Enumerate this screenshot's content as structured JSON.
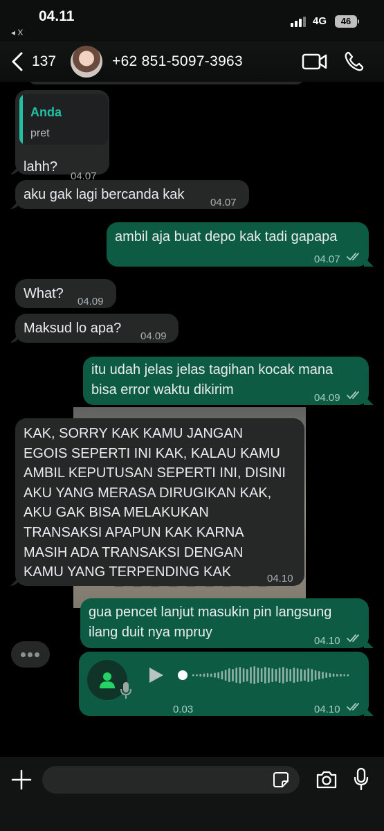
{
  "status_bar": {
    "time": "04.11",
    "back_app": "◂ X",
    "network": "4G",
    "battery": "46"
  },
  "header": {
    "unread_count": "137",
    "contact_name": "+62 851-5097-3963"
  },
  "messages": [
    {
      "id": "m1",
      "direction": "in",
      "quote_author": "Anda",
      "quote_text": "pret",
      "text": "lahh?",
      "time": "04.07"
    },
    {
      "id": "m2",
      "direction": "in",
      "text": "aku gak lagi bercanda kak",
      "time": "04.07"
    },
    {
      "id": "m3",
      "direction": "out",
      "text": "ambil aja buat depo kak tadi gapapa",
      "time": "04.07",
      "read": true
    },
    {
      "id": "m4",
      "direction": "in",
      "text": "What?",
      "time": "04.09"
    },
    {
      "id": "m5",
      "direction": "in",
      "text": "Maksud lo apa?",
      "time": "04.09"
    },
    {
      "id": "m6",
      "direction": "out",
      "text": "itu udah jelas jelas tagihan kocak mana\nbisa error waktu dikirim",
      "time": "04.09",
      "read": true
    },
    {
      "id": "m7",
      "direction": "in",
      "text": "KAK, SORRY KAK KAMU JANGAN\nEGOIS SEPERTI INI KAK, KALAU KAMU\nAMBIL KEPUTUSAN SEPERTI INI, DISINI\nAKU YANG MERASA DIRUGIKAN KAK,\nAKU GAK BISA MELAKUKAN\nTRANSAKSI APAPUN KAK KARNA\nMASIH ADA TRANSAKSI DENGAN\nKAMU YANG TERPENDING KAK",
      "time": "04.10"
    },
    {
      "id": "m8",
      "direction": "out",
      "text": "gua pencet lanjut masukin pin langsung\nilang duit nya mpruy",
      "time": "04.10",
      "read": true
    },
    {
      "id": "m9",
      "direction": "out",
      "type": "voice",
      "duration": "0.03",
      "time": "04.10",
      "read": true
    }
  ],
  "input": {
    "placeholder": "",
    "value": ""
  },
  "icons": {
    "back": "chevron-left-icon",
    "video": "video-camera-icon",
    "call": "phone-icon",
    "plus": "plus-icon",
    "sticker": "sticker-icon",
    "camera": "camera-icon",
    "mic": "microphone-icon"
  },
  "colors": {
    "incoming_bubble": "#262828",
    "outgoing_bubble": "#0d5b43",
    "accent": "#21c1a4",
    "read_ticks": "#a7cfbf"
  }
}
